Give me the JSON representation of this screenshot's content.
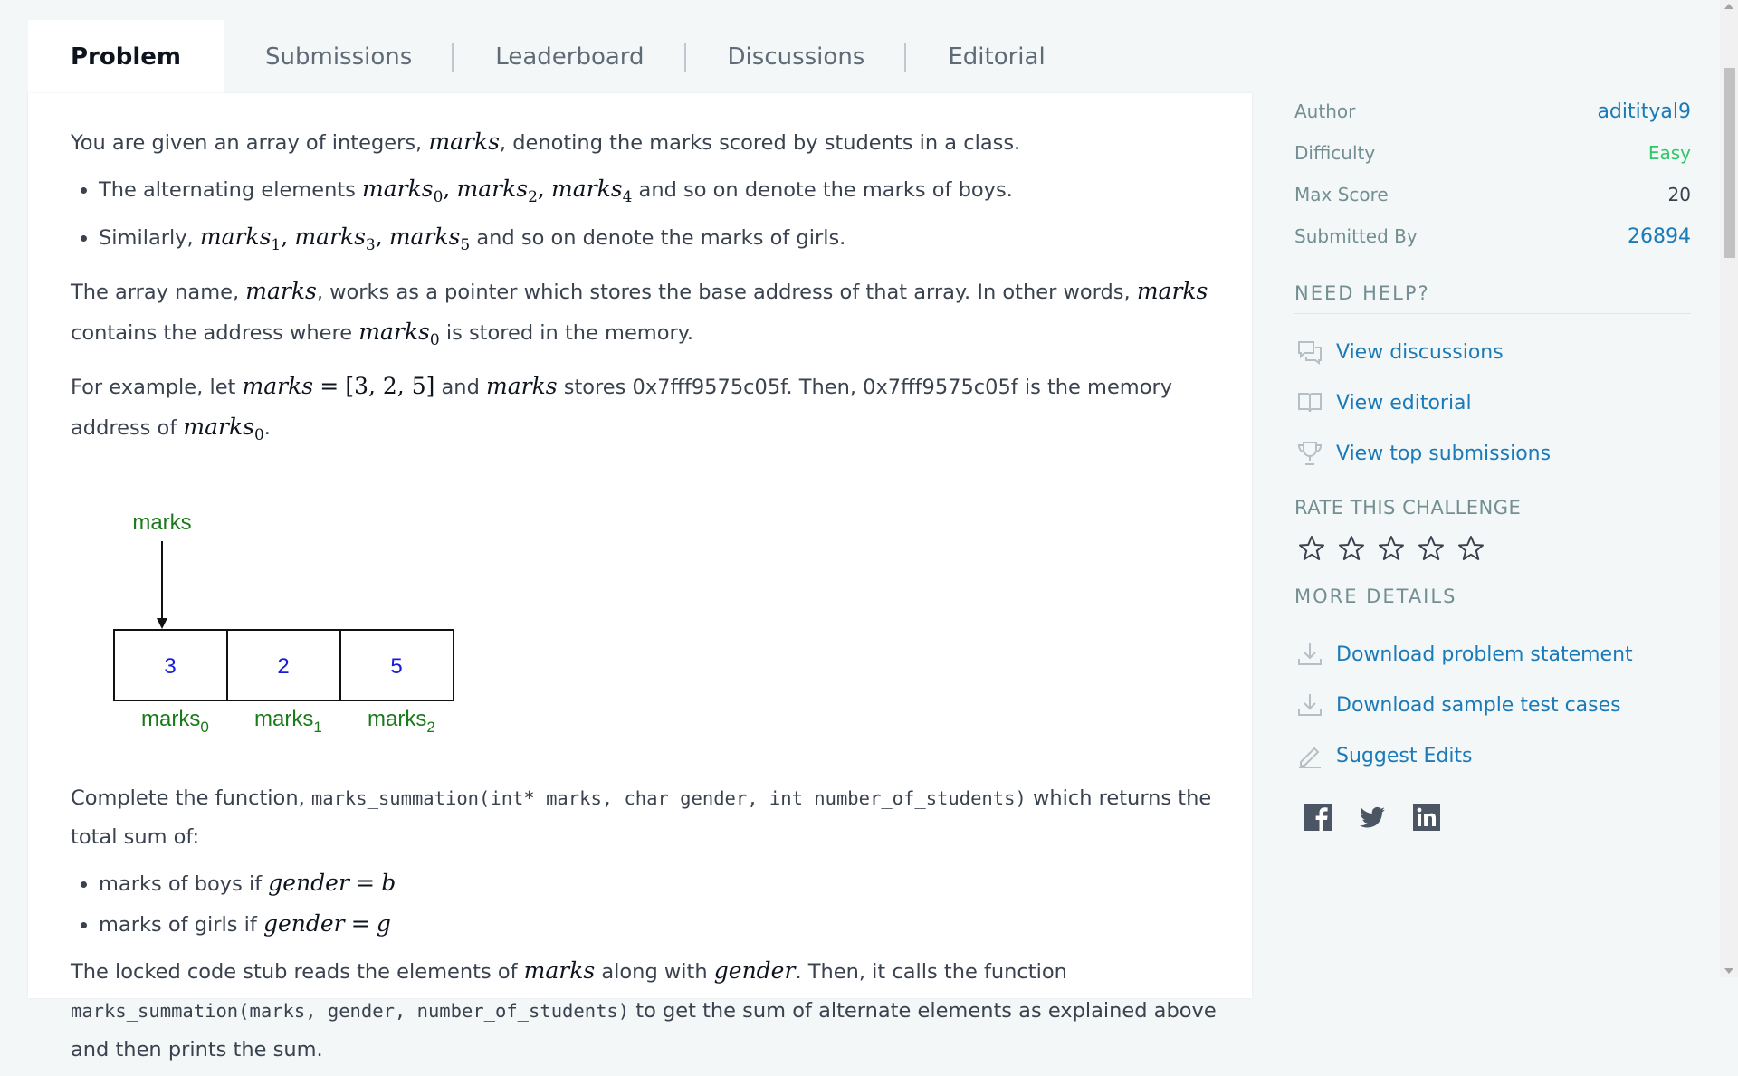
{
  "tabs": [
    {
      "label": "Problem",
      "active": true
    },
    {
      "label": "Submissions"
    },
    {
      "label": "Leaderboard"
    },
    {
      "label": "Discussions"
    },
    {
      "label": "Editorial"
    }
  ],
  "problem": {
    "intro_a": "You are given an array of integers,",
    "intro_var": "marks",
    "intro_b": ", denoting the marks scored by students in a class.",
    "bullet1_a": "The alternating elements",
    "bullet1_b": "and so on denote the marks of boys.",
    "bullet2_a": "Similarly,",
    "bullet2_b": "and so on denote the marks of girls.",
    "para2_a": "The array name,",
    "para2_b": ", works as a pointer which stores the base address of that array. In other words,",
    "para2_c": "contains the address where",
    "para2_d": "is stored in the memory.",
    "para3_a": "For example, let",
    "para3_b": "and",
    "para3_c": "stores 0x7fff9575c05f. Then, 0x7fff9575c05f is the memory address of",
    "para4_a": "Complete the function,",
    "para4_code": "marks_summation(int* marks, char gender, int number_of_students)",
    "para4_b": "which returns the total sum of:",
    "bullet3_a": "marks of boys if",
    "bullet4_a": "marks of girls if",
    "para5_a": "The locked code stub reads the elements of",
    "para5_b": "along with",
    "para5_c": ". Then, it calls the function",
    "para5_code": "marks_summation(marks, gender, number_of_students)",
    "para5_d": "to get the sum of alternate elements as explained above and then prints the sum."
  },
  "math": {
    "marks": "marks",
    "gender": "gender",
    "array_literal": "[3, 2, 5]",
    "eq": "=",
    "b": "b",
    "g": "g",
    "sub0": "0",
    "sub1": "1",
    "sub2": "2",
    "sub3": "3",
    "sub4": "4",
    "sub5": "5",
    "comma": ","
  },
  "diagram": {
    "pointer_label": "marks",
    "cells": [
      "3",
      "2",
      "5"
    ],
    "cell_labels": [
      "marks",
      "marks",
      "marks"
    ],
    "cell_subs": [
      "0",
      "1",
      "2"
    ],
    "label_color": "#1b7a1b",
    "value_color": "#1a1adb"
  },
  "sidebar": {
    "meta": [
      {
        "label": "Author",
        "value": "aditityal9",
        "style": "link"
      },
      {
        "label": "Difficulty",
        "value": "Easy",
        "style": "easy"
      },
      {
        "label": "Max Score",
        "value": "20",
        "style": "plain"
      },
      {
        "label": "Submitted By",
        "value": "26894",
        "style": "link"
      }
    ],
    "need_help_title": "NEED HELP?",
    "help_links": [
      {
        "label": "View discussions",
        "icon": "discussions-icon"
      },
      {
        "label": "View editorial",
        "icon": "book-icon"
      },
      {
        "label": "View top submissions",
        "icon": "trophy-icon"
      }
    ],
    "rate_title": "RATE THIS CHALLENGE",
    "stars": 5,
    "more_details_title": "MORE DETAILS",
    "detail_links": [
      {
        "label": "Download problem statement",
        "icon": "download-icon"
      },
      {
        "label": "Download sample test cases",
        "icon": "download-icon"
      },
      {
        "label": "Suggest Edits",
        "icon": "pencil-icon"
      }
    ],
    "social": [
      "facebook-icon",
      "twitter-icon",
      "linkedin-icon"
    ]
  },
  "colors": {
    "link": "#1b7ab8",
    "easy": "#2ec866",
    "background": "#f3f7f7"
  }
}
